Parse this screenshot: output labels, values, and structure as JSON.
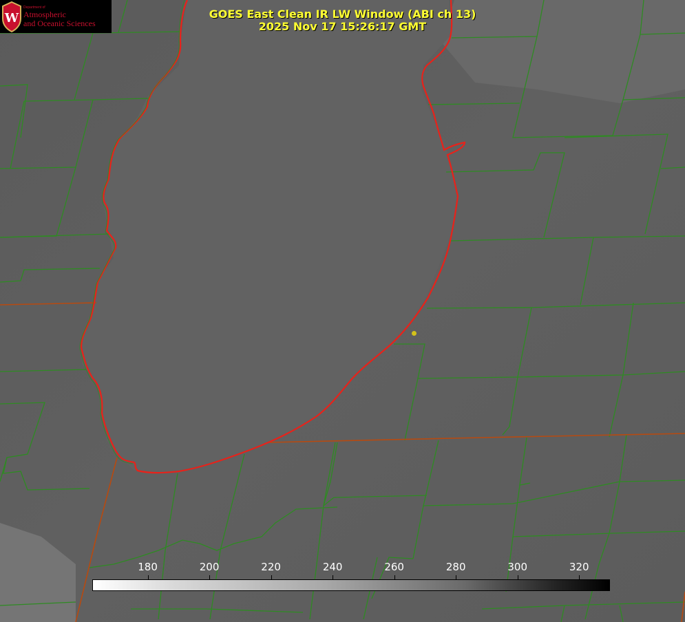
{
  "header": {
    "title_line1": "GOES East Clean IR LW Window (ABI ch 13)",
    "title_line2": "2025 Nov 17 15:26:17 GMT"
  },
  "logo": {
    "dept": "Department of",
    "line1": "Atmospheric",
    "line2": "and Oceanic Sciences",
    "shield_letter": "W"
  },
  "colors": {
    "boundary_green": "#2e8b22",
    "coastline_red": "#e8221a",
    "state_line": "#b84a10",
    "title_yellow": "#ffff33",
    "station_yellow": "#d4c21a"
  },
  "colorbar": {
    "ticks": [
      "180",
      "200",
      "220",
      "240",
      "260",
      "280",
      "300",
      "320"
    ],
    "tick_values": [
      180,
      200,
      220,
      240,
      260,
      280,
      300,
      320
    ],
    "range": [
      162,
      330
    ]
  }
}
